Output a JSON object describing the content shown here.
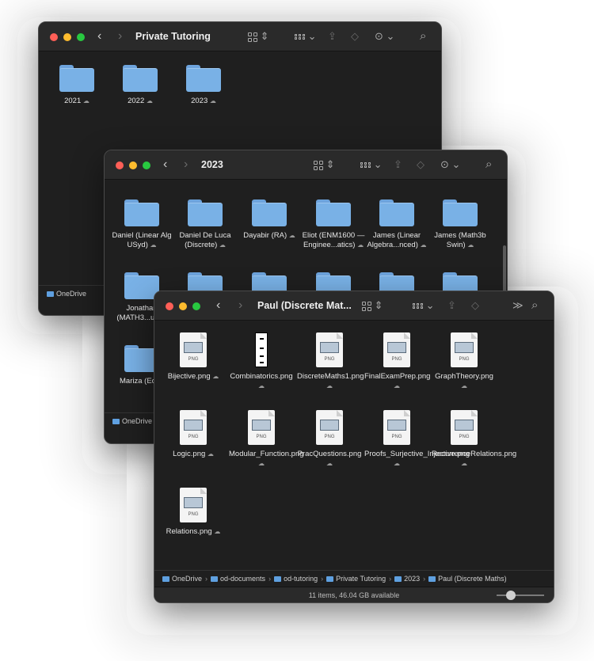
{
  "windows": {
    "private": {
      "title": "Private Tutoring",
      "folders": [
        {
          "name": "2021"
        },
        {
          "name": "2022"
        },
        {
          "name": "2023"
        }
      ],
      "path_root": "OneDrive"
    },
    "year": {
      "title": "2023",
      "folders_row1": [
        {
          "name": "Daniel (Linear Alg USyd)"
        },
        {
          "name": "Daniel De Luca (Discrete)"
        },
        {
          "name": "Dayabir (RA)"
        },
        {
          "name": "Eliot (ENM1600 — Enginee...atics)"
        },
        {
          "name": "James (Linear Algebra...nced)"
        },
        {
          "name": "James (Math3b Swin)"
        }
      ],
      "folders_row2": [
        {
          "name": "Jonathan (MATH3...ulus)"
        }
      ],
      "folders_row3": [
        {
          "name": "Mariza (Econ"
        }
      ],
      "path_root": "OneDrive"
    },
    "paul": {
      "title": "Paul (Discrete Mat...",
      "files": [
        {
          "name": "Bijective.png"
        },
        {
          "name": "Combinatorics.png"
        },
        {
          "name": "DiscreteMaths1.png"
        },
        {
          "name": "FinalExamPrep.png"
        },
        {
          "name": "GraphTheory.png"
        },
        {
          "name": "Logic.png"
        },
        {
          "name": "Modular_Function.png"
        },
        {
          "name": "PracQuestions.png"
        },
        {
          "name": "Proofs_Surjective_Injective.png"
        },
        {
          "name": "RecurrenceRelations.png"
        },
        {
          "name": "Relations.png"
        }
      ],
      "path": [
        "OneDrive",
        "od-documents",
        "od-tutoring",
        "Private Tutoring",
        "2023",
        "Paul (Discrete Maths)"
      ],
      "status": "11 items, 46.04 GB available"
    }
  },
  "icons": {
    "cloud": "☁",
    "back": "‹",
    "forward": "›",
    "search": "⌕",
    "more": "≫",
    "share": "⇪",
    "tag": "◇",
    "ellipsis": "⊙"
  },
  "file_type_label": "PNG"
}
